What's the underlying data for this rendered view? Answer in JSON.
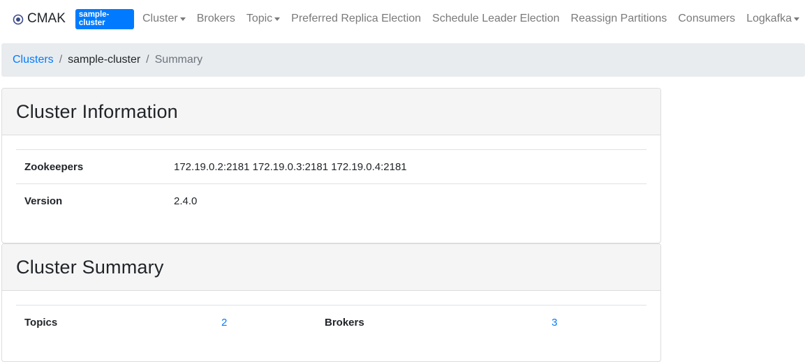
{
  "navbar": {
    "brand": "CMAK",
    "cluster_badge": "sample-cluster",
    "items": [
      {
        "label": "Cluster",
        "dropdown": true
      },
      {
        "label": "Brokers",
        "dropdown": false
      },
      {
        "label": "Topic",
        "dropdown": true
      },
      {
        "label": "Preferred Replica Election",
        "dropdown": false
      },
      {
        "label": "Schedule Leader Election",
        "dropdown": false
      },
      {
        "label": "Reassign Partitions",
        "dropdown": false
      },
      {
        "label": "Consumers",
        "dropdown": false
      },
      {
        "label": "Logkafka",
        "dropdown": true
      }
    ]
  },
  "breadcrumb": {
    "clusters": "Clusters",
    "cluster": "sample-cluster",
    "current": "Summary",
    "separator": "/"
  },
  "cluster_info": {
    "title": "Cluster Information",
    "zookeepers_label": "Zookeepers",
    "zookeepers_value": "172.19.0.2:2181 172.19.0.3:2181 172.19.0.4:2181",
    "version_label": "Version",
    "version_value": "2.4.0"
  },
  "cluster_summary": {
    "title": "Cluster Summary",
    "topics_label": "Topics",
    "topics_value": "2",
    "brokers_label": "Brokers",
    "brokers_value": "3"
  },
  "colors": {
    "accent": "#007bff",
    "breadcrumb_bg": "#e9ecef",
    "card_header_bg": "#f5f5f5",
    "nav_text": "#7a7a7a"
  },
  "icons": {
    "brand": "target-icon",
    "dropdown": "caret-down-icon"
  }
}
